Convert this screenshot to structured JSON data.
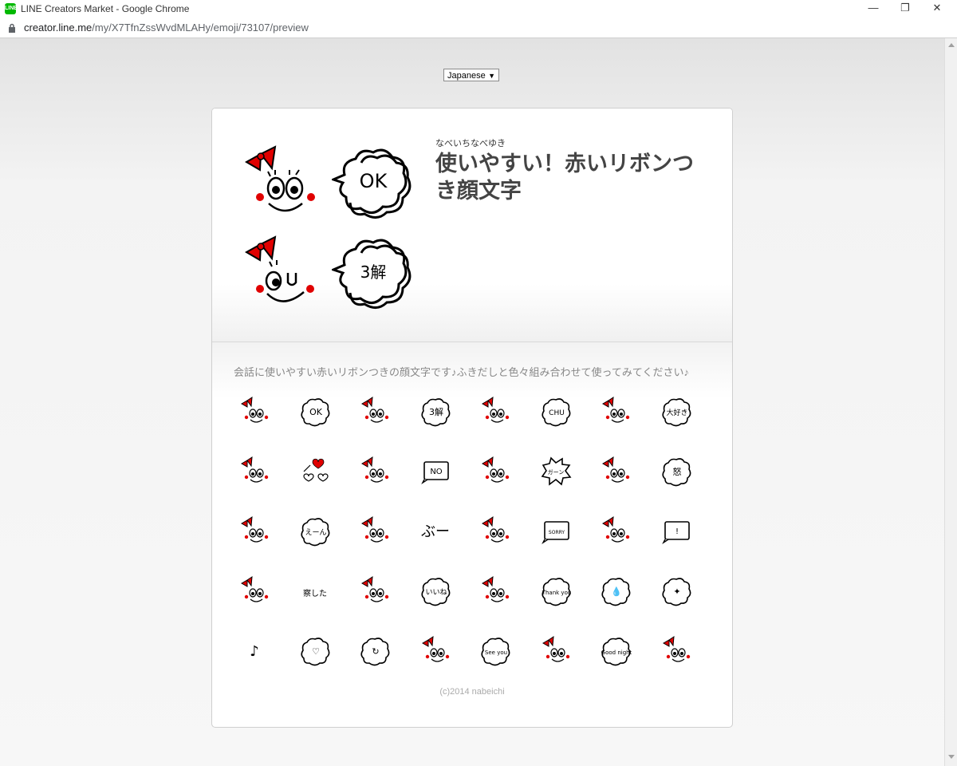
{
  "window": {
    "title": "LINE Creators Market - Google Chrome",
    "app_icon_text": "LINE",
    "minimize_glyph": "—",
    "restore_glyph": "❐",
    "close_glyph": "✕"
  },
  "addressbar": {
    "url_host": "creator.line.me",
    "url_path": "/my/X7TfnZssWvdMLAHy/emoji/73107/preview"
  },
  "language_select": {
    "selected": "Japanese",
    "caret": "▼"
  },
  "pack": {
    "author": "なべいちなべゆき",
    "title": "使いやすい！赤いリボンつき顔文字",
    "description": "会話に使いやすい赤いリボンつきの顔文字です♪ふきだしと色々組み合わせて使ってみてください♪",
    "copyright": "(c)2014 nabeichi"
  },
  "hero": {
    "bubble_texts": [
      "OK",
      "3解"
    ]
  },
  "emojis": [
    {
      "kind": "face",
      "icon": "ribbon-face-smile-icon"
    },
    {
      "kind": "cloud",
      "text": "OK",
      "icon": "ok-bubble-icon"
    },
    {
      "kind": "face",
      "icon": "ribbon-face-wink-icon"
    },
    {
      "kind": "cloud",
      "text": "3解",
      "icon": "ryokai-bubble-icon"
    },
    {
      "kind": "face",
      "icon": "ribbon-face-uu-icon"
    },
    {
      "kind": "cloud",
      "text": "CHU",
      "icon": "chu-bubble-icon"
    },
    {
      "kind": "face",
      "icon": "ribbon-face-tongue-icon"
    },
    {
      "kind": "cloud",
      "text": "大好き",
      "icon": "daisuki-bubble-icon"
    },
    {
      "kind": "face",
      "icon": "ribbon-face-cheer-icon"
    },
    {
      "kind": "hearts",
      "icon": "hearts-icon"
    },
    {
      "kind": "face",
      "icon": "ribbon-face-kiss-icon"
    },
    {
      "kind": "box",
      "text": "NO",
      "icon": "no-box-icon"
    },
    {
      "kind": "face",
      "icon": "ribbon-face-shock-icon"
    },
    {
      "kind": "burst",
      "text": "ガーン",
      "icon": "gaan-burst-icon"
    },
    {
      "kind": "face",
      "icon": "ribbon-face-nervous-icon"
    },
    {
      "kind": "cloud",
      "text": "怒",
      "icon": "angry-bubble-icon"
    },
    {
      "kind": "face",
      "icon": "ribbon-face-cry-icon"
    },
    {
      "kind": "cloud",
      "text": "えーん",
      "icon": "een-bubble-icon"
    },
    {
      "kind": "face",
      "icon": "ribbon-face-pout-icon"
    },
    {
      "kind": "text",
      "text": "ぶー",
      "icon": "buu-text-icon"
    },
    {
      "kind": "face",
      "icon": "ribbon-face-squint-icon"
    },
    {
      "kind": "box",
      "text": "SORRY",
      "icon": "sorry-box-icon"
    },
    {
      "kind": "face",
      "icon": "ribbon-face-surprised-icon"
    },
    {
      "kind": "box",
      "text": "!",
      "icon": "exclamation-box-icon"
    },
    {
      "kind": "face",
      "icon": "ribbon-face-laugh-icon"
    },
    {
      "kind": "text",
      "text": "察した",
      "icon": "sasshita-text-icon"
    },
    {
      "kind": "face",
      "icon": "ribbon-face-happy-icon"
    },
    {
      "kind": "cloud",
      "text": "いいね",
      "icon": "iine-bubble-icon"
    },
    {
      "kind": "face",
      "icon": "ribbon-face-grin-icon"
    },
    {
      "kind": "cloud",
      "text": "Thank you",
      "icon": "thankyou-bubble-icon"
    },
    {
      "kind": "cloud",
      "text": "💧",
      "icon": "sweat-bubble-icon"
    },
    {
      "kind": "cloud",
      "text": "✦",
      "icon": "sparkle-bubble-icon"
    },
    {
      "kind": "text",
      "text": "♪",
      "icon": "music-notes-icon"
    },
    {
      "kind": "cloud",
      "text": "♡",
      "icon": "heart-face-bubble-icon"
    },
    {
      "kind": "cloud",
      "text": "↻",
      "icon": "recycle-bubble-icon"
    },
    {
      "kind": "face",
      "icon": "ribbon-face-side-icon"
    },
    {
      "kind": "cloud",
      "text": "See you",
      "icon": "seeyou-bubble-icon"
    },
    {
      "kind": "face",
      "icon": "ribbon-face-blush-icon"
    },
    {
      "kind": "cloud",
      "text": "Good night",
      "icon": "goodnight-bubble-icon"
    },
    {
      "kind": "face",
      "icon": "ribbon-moon-face-icon"
    }
  ]
}
